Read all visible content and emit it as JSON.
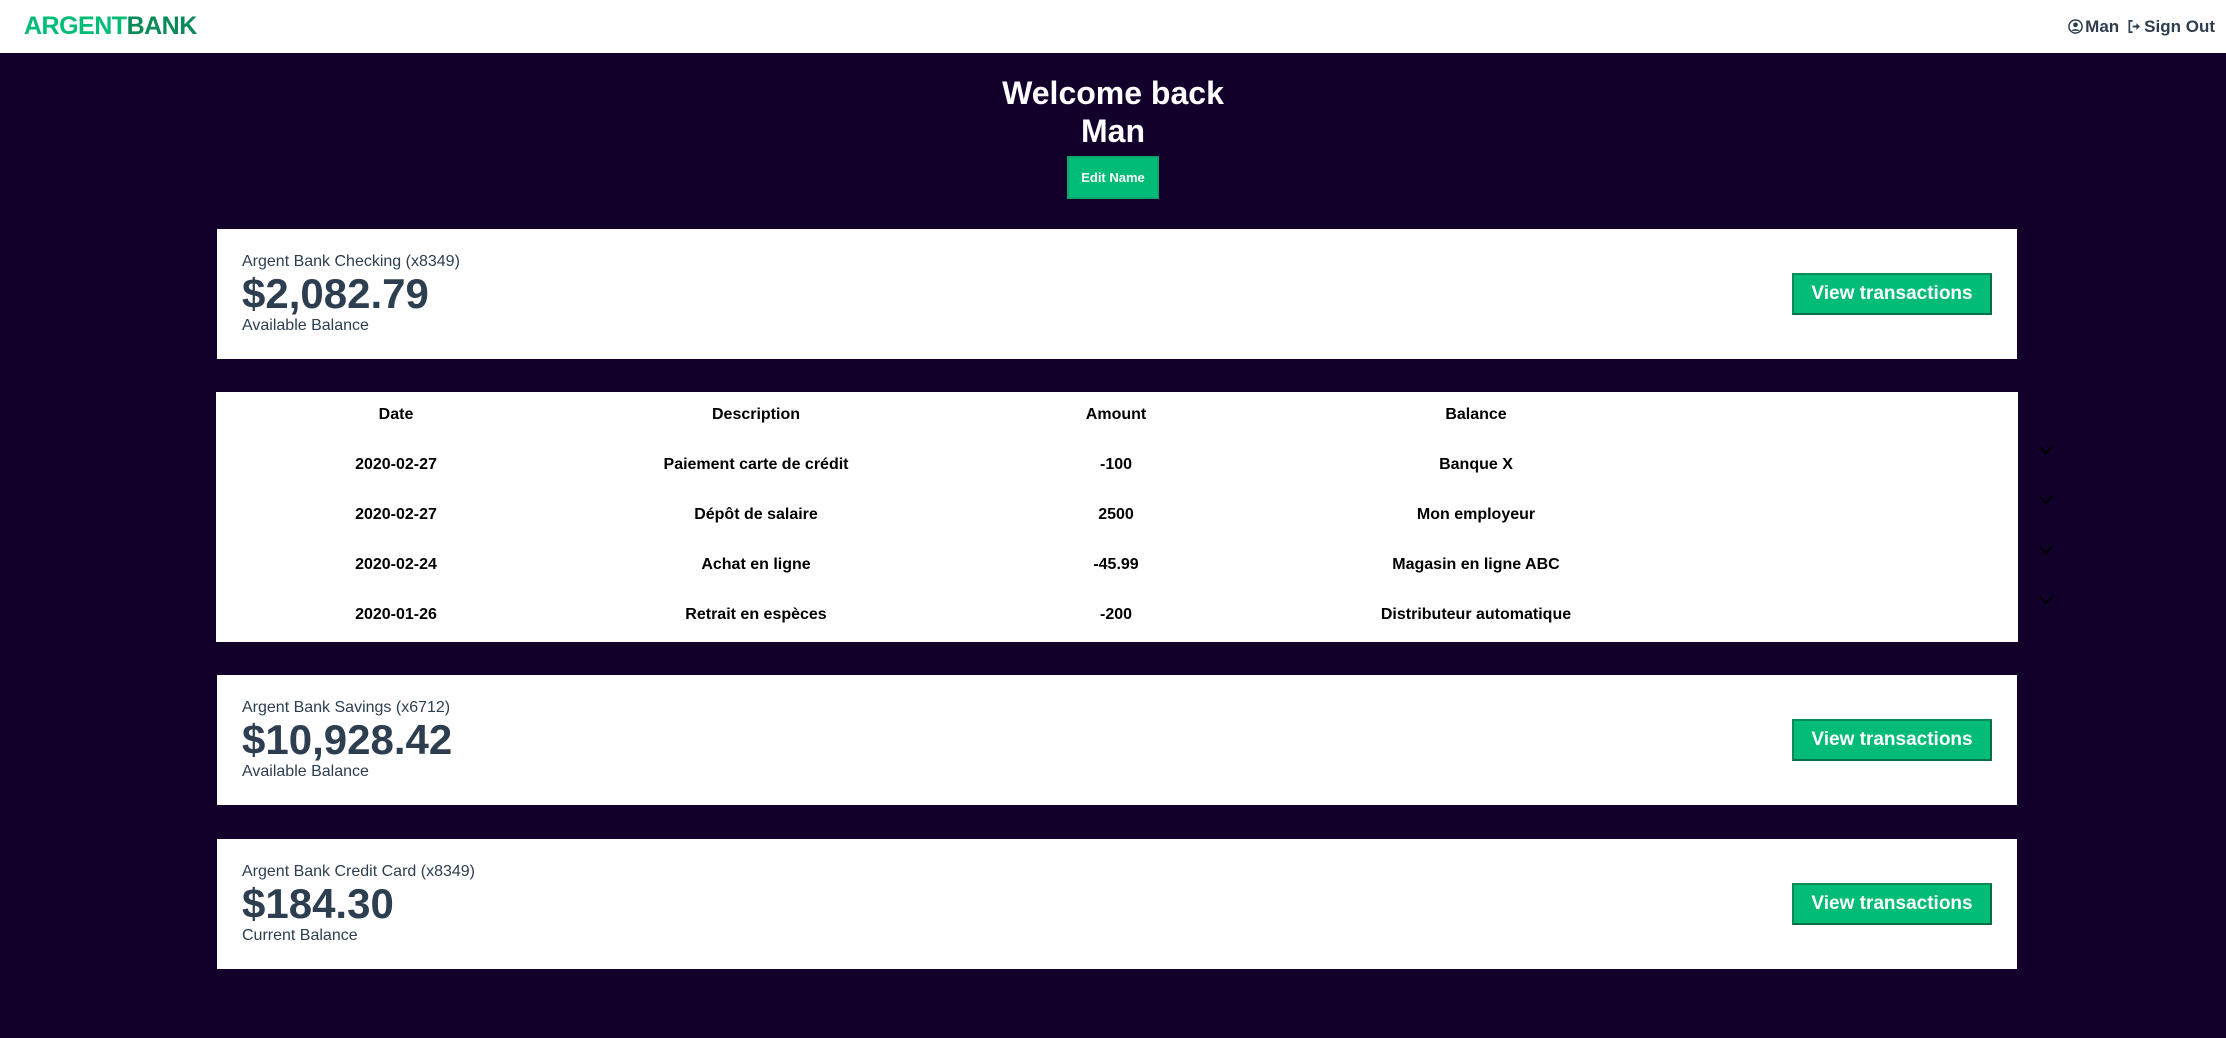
{
  "navbar": {
    "logo_part1": "ARGENT",
    "logo_part2": "BANK",
    "user_name": "Man",
    "sign_out": "Sign Out",
    "user_icon": "user-circle-icon",
    "sign_out_icon": "sign-out-icon"
  },
  "header": {
    "welcome": "Welcome back",
    "name": "Man",
    "edit_button": "Edit Name"
  },
  "accounts": [
    {
      "title": "Argent Bank Checking (x8349)",
      "amount": "$2,082.79",
      "description": "Available Balance",
      "button": "View transactions"
    },
    {
      "title": "Argent Bank Savings (x6712)",
      "amount": "$10,928.42",
      "description": "Available Balance",
      "button": "View transactions"
    },
    {
      "title": "Argent Bank Credit Card (x8349)",
      "amount": "$184.30",
      "description": "Current Balance",
      "button": "View transactions"
    }
  ],
  "transactions": {
    "headers": [
      "Date",
      "Description",
      "Amount",
      "Balance"
    ],
    "rows": [
      [
        "2020-02-27",
        "Paiement carte de crédit",
        "-100",
        "Banque X"
      ],
      [
        "2020-02-27",
        "Dépôt de salaire",
        "2500",
        "Mon employeur"
      ],
      [
        "2020-02-24",
        "Achat en ligne",
        "-45.99",
        "Magasin en ligne ABC"
      ],
      [
        "2020-01-26",
        "Retrait en espèces",
        "-200",
        "Distributeur automatique"
      ]
    ],
    "expand_icon": "chevron-down-icon"
  },
  "colors": {
    "background": "#12002b",
    "accent": "#00bc77",
    "text": "#2c3e50"
  }
}
